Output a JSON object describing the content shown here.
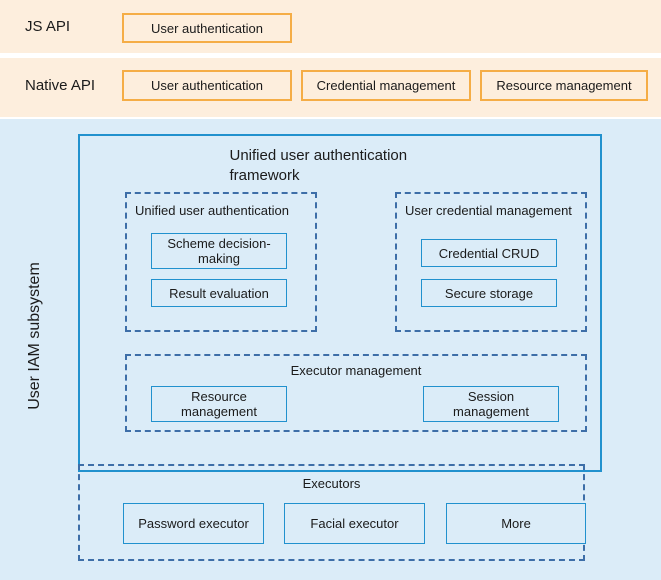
{
  "colors": {
    "api_band_bg": "#fdeedd",
    "api_box_border": "#f5ad46",
    "subsystem_bg": "#dbecf8",
    "solid_box_border": "#2191ce",
    "dashed_box_border": "#3d6ea8",
    "page_bg": "#ffffff",
    "text": "#1b1b1b"
  },
  "bands": {
    "js_api": {
      "label": "JS API",
      "boxes": [
        {
          "label": "User authentication"
        }
      ]
    },
    "native_api": {
      "label": "Native API",
      "boxes": [
        {
          "label": "User authentication"
        },
        {
          "label": "Credential management"
        },
        {
          "label": "Resource management"
        }
      ]
    }
  },
  "subsystem": {
    "label": "User IAM subsystem",
    "framework": {
      "title_line1": "Unified user authentication",
      "title_line2": "framework",
      "groups": [
        {
          "title": "Unified user authentication",
          "boxes": [
            {
              "line1": "Scheme decision-",
              "line2": "making"
            },
            {
              "line1": "Result evaluation",
              "line2": ""
            }
          ]
        },
        {
          "title": "User credential management",
          "boxes": [
            {
              "line1": "Credential CRUD",
              "line2": ""
            },
            {
              "line1": "Secure storage",
              "line2": ""
            }
          ]
        }
      ],
      "executor_management": {
        "title": "Executor management",
        "boxes": [
          {
            "line1": "Resource",
            "line2": "management"
          },
          {
            "line1": "Session",
            "line2": "management"
          }
        ]
      }
    },
    "executors": {
      "title": "Executors",
      "boxes": [
        {
          "label": "Password executor"
        },
        {
          "label": "Facial executor"
        },
        {
          "label": "More"
        }
      ]
    }
  }
}
